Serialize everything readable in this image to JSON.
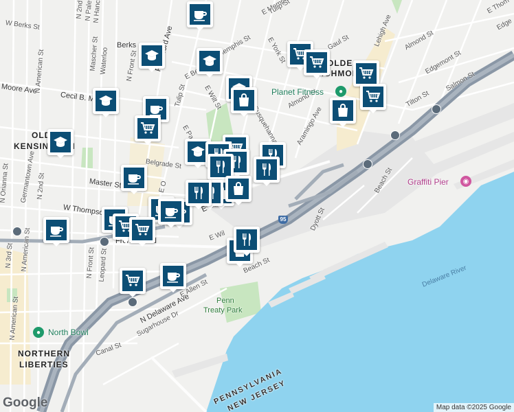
{
  "streets": {
    "n_2nd": "N 2nd St",
    "n_palethorp": "N Palethorp",
    "n_hancock": "N Hancock",
    "w_berks": "W Berks St",
    "berks": "Berks",
    "mascher": "Mascher St",
    "waterloo": "Waterloo",
    "moore": "Moore Ave",
    "cecil_b": "Cecil B. M",
    "n_american_top": "N American St",
    "n_front_top": "N Front St",
    "frankford": "Frankford Ave",
    "e_berks": "E Berks St",
    "memphis_a": "Memphis St",
    "e_memphis": "E Memphis St",
    "tulip_top": "Tulip St",
    "e_york": "E York St",
    "e_wilt": "E Wilt St",
    "tulip_mid": "Tulip St",
    "e_pa": "E Pa",
    "shamokin": "Shamokin",
    "susquehanna": "Susquehanna Ave",
    "almond_mid": "Almond St",
    "aramingo": "Aramingo Ave",
    "lehigh": "Lehigh Ave",
    "gaul": "Gaul St",
    "almond_right": "Almond St",
    "edgemont": "Edgemont St",
    "e_thom": "E Thom",
    "edge_tr": "Edge",
    "salmon": "Salmon St",
    "tilton": "Tilton St",
    "belgrade": "Belgrade St",
    "master": "Master St",
    "w_thompson": "W Thompson",
    "e_girard": "E Girard Ave",
    "e_wil": "E Wil",
    "beach_mid": "Beach St",
    "beach_right": "Beach St",
    "dyott": "Dyott St",
    "n_front_mid": "N Front St",
    "leopard": "Leopard St",
    "e_allen": "E Allen St",
    "n_delaware": "N Delaware Ave",
    "sugarhouse": "Sugarhouse Dr",
    "canal": "Canal St",
    "n_american_bot": "N American St",
    "n_3rd": "N 3rd St",
    "n_orianna": "N Orianna St",
    "germantown": "Germantown Ave",
    "n_2nd_mid": "N 2nd St",
    "n_american_mid": "N American St",
    "mid_st": "St",
    "e_o": "E O",
    "front_girard": "Front-Girard",
    "thompson": "Thompson"
  },
  "areas": {
    "olde_kensington_1": "OLDE",
    "olde_kensington_2": "KENSINGTON",
    "olde_richmond_1": "OLDE",
    "olde_richmond_2": "RICHMOND",
    "northern_1": "NORTHERN",
    "northern_2": "LIBERTIES"
  },
  "pois": {
    "planet_fitness": "Planet Fitness",
    "graffiti_pier": "Graffiti Pier",
    "north_bowl": "North Bowl",
    "penn_treaty_1": "Penn",
    "penn_treaty_2": "Treaty Park"
  },
  "water": {
    "delaware_river": "Delaware River"
  },
  "states": {
    "pennsylvania": "PENNSYLVANIA",
    "new_jersey": "NEW JERSEY"
  },
  "highway": {
    "i95": "95"
  },
  "markers": [
    {
      "type": "cafe"
    },
    {
      "type": "school"
    },
    {
      "type": "school"
    },
    {
      "type": "grocery"
    },
    {
      "type": "grocery"
    },
    {
      "type": "grocery"
    },
    {
      "type": "school"
    },
    {
      "type": "school"
    },
    {
      "type": "shopping"
    },
    {
      "type": "cafe"
    },
    {
      "type": "grocery"
    },
    {
      "type": "grocery"
    },
    {
      "type": "shopping"
    },
    {
      "type": "grocery"
    },
    {
      "type": "school"
    },
    {
      "type": "school"
    },
    {
      "type": "restaurant"
    },
    {
      "type": "restaurant"
    },
    {
      "type": "restaurant"
    },
    {
      "type": "restaurant"
    },
    {
      "type": "cafe"
    },
    {
      "type": "shopping"
    },
    {
      "type": "restaurant"
    },
    {
      "type": "shopping"
    },
    {
      "type": "restaurant"
    },
    {
      "type": "cafe"
    },
    {
      "type": "cafe"
    },
    {
      "type": "grocery"
    },
    {
      "type": "cafe"
    },
    {
      "type": "cafe"
    },
    {
      "type": "restaurant"
    },
    {
      "type": "shopping"
    },
    {
      "type": "cafe"
    },
    {
      "type": "grocery"
    },
    {
      "type": "grocery"
    },
    {
      "type": "cafe"
    },
    {
      "type": "restaurant"
    }
  ],
  "branding": {
    "logo": "Google"
  },
  "attribution": "Map data ©2025 Google",
  "colors": {
    "marker": "#0c4e75",
    "water": "#8fd3ef",
    "highway": "#8a97a6",
    "park": "#c8e6c0"
  }
}
